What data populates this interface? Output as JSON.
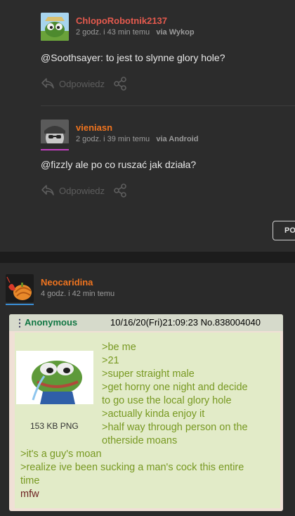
{
  "comments": [
    {
      "author": "ChlopoRobotnik2137",
      "author_color": "#e55a4e",
      "time": "2 godz. i 43 min temu",
      "via": "via Wykop",
      "mention": "@Soothsayer",
      "text": ": to jest to slynne glory hole?",
      "reply_label": "Odpowiedz"
    },
    {
      "author": "vieniasn",
      "author_color": "#f0741f",
      "time": "2 godz. i 39 min temu",
      "via": "via Android",
      "mention": "@fizzly",
      "text": " ale po co ruszać jak działa?",
      "reply_label": "Odpowiedz"
    }
  ],
  "post_button_label": "PO",
  "entry": {
    "author": "Neocaridina",
    "author_color": "#f0741f",
    "time": "4 godz. i 42 min temu"
  },
  "chan_post": {
    "name": "Anonymous",
    "datetime": "10/16/20(Fri)21:09:23 No.838004040",
    "file_size": "153 KB PNG",
    "lines": [
      ">be me",
      ">21",
      ">super straight male",
      ">get horny one night and decide",
      "to go use the local glory hole",
      ">actually kinda enjoy it",
      ">half way through person on the",
      "otherside moans"
    ],
    "full_lines": [
      ">it's a guy's moan",
      ">realize ive been sucking a man's cock this entire",
      "time"
    ],
    "ending": "mfw"
  }
}
